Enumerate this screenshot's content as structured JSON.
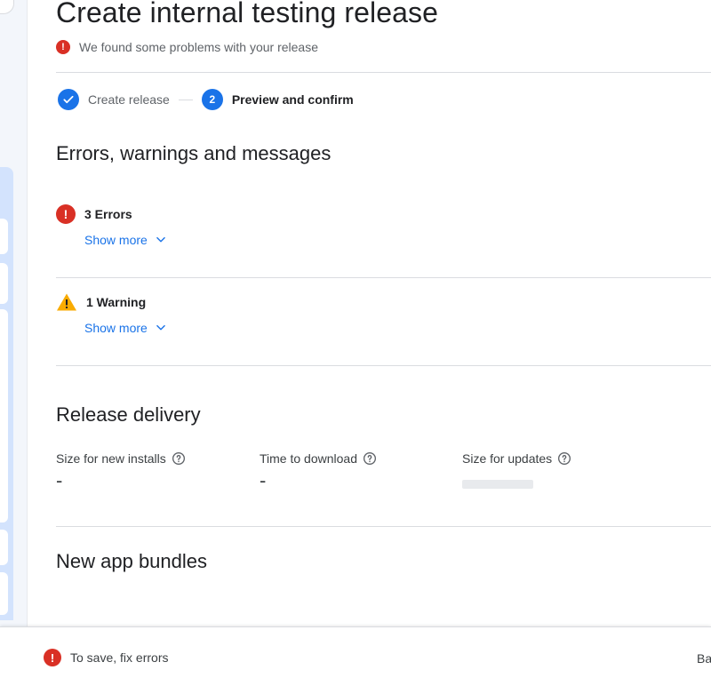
{
  "header": {
    "title": "Create internal testing release",
    "problem_text": "We found some problems with your release"
  },
  "stepper": {
    "step1_label": "Create release",
    "step2_number": "2",
    "step2_label": "Preview and confirm"
  },
  "issues": {
    "section_title": "Errors, warnings and messages",
    "errors_label": "3 Errors",
    "errors_show_more": "Show more",
    "warnings_label": "1 Warning",
    "warnings_show_more": "Show more"
  },
  "delivery": {
    "section_title": "Release delivery",
    "metrics": [
      {
        "label": "Size for new installs",
        "value": "-"
      },
      {
        "label": "Time to download",
        "value": "-"
      },
      {
        "label": "Size for updates",
        "value": ""
      }
    ]
  },
  "bundles": {
    "section_title": "New app bundles"
  },
  "footer": {
    "message": "To save, fix errors",
    "back_label": "Ba"
  },
  "colors": {
    "accent": "#1a73e8",
    "error": "#d93025",
    "warning": "#f9ab00"
  },
  "icons": [
    "error-icon",
    "check-icon",
    "warning-icon",
    "chevron-down-icon",
    "help-icon"
  ]
}
